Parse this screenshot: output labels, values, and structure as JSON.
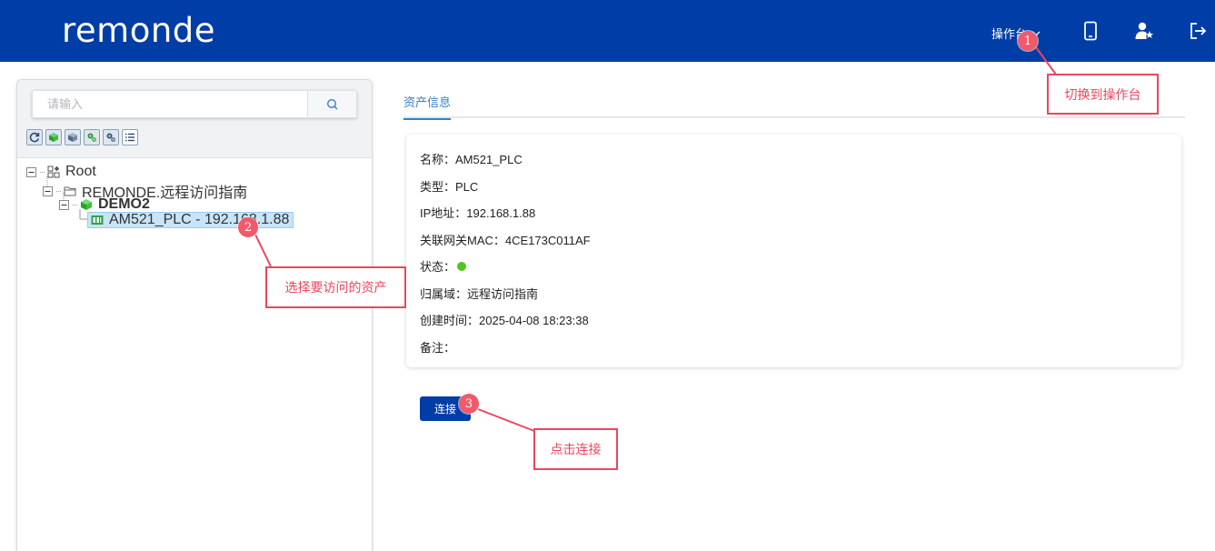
{
  "header": {
    "logo_text": "remonde",
    "console_menu_label": "操作台",
    "icons": [
      "mobile-icon",
      "user-star-icon",
      "logout-icon"
    ]
  },
  "sidebar": {
    "search_placeholder": "请输入",
    "toolbar_icons": [
      "refresh-icon",
      "cube-green-icon",
      "cube-icon",
      "settings-green-icon",
      "settings-icon",
      "list-icon"
    ],
    "tree": {
      "root": "Root",
      "folder": "REMONDE.远程访问指南",
      "gateway": "DEMO2",
      "asset": "AM521_PLC - 192.168.1.88"
    }
  },
  "main": {
    "tab_label": "资产信息",
    "info": {
      "name": "名称：AM521_PLC",
      "type": "类型：PLC",
      "ip": "IP地址：192.168.1.88",
      "mac": "关联网关MAC：4CE173C011AF",
      "status_label": "状态：",
      "domain": "归属域：远程访问指南",
      "created": "创建时间：2025-04-08 18:23:38",
      "remark": "备注："
    },
    "connect_label": "连接"
  },
  "annotations": {
    "badge_1": "1",
    "badge_2": "2",
    "badge_3": "3",
    "callout_1": "切换到操作台",
    "callout_2": "选择要访问的资产",
    "callout_3": "点击连接"
  },
  "colors": {
    "header_bg": "#003da6",
    "accent": "#3b7fc4",
    "status_online": "#52c41a",
    "callout_red": "#e8475f"
  }
}
